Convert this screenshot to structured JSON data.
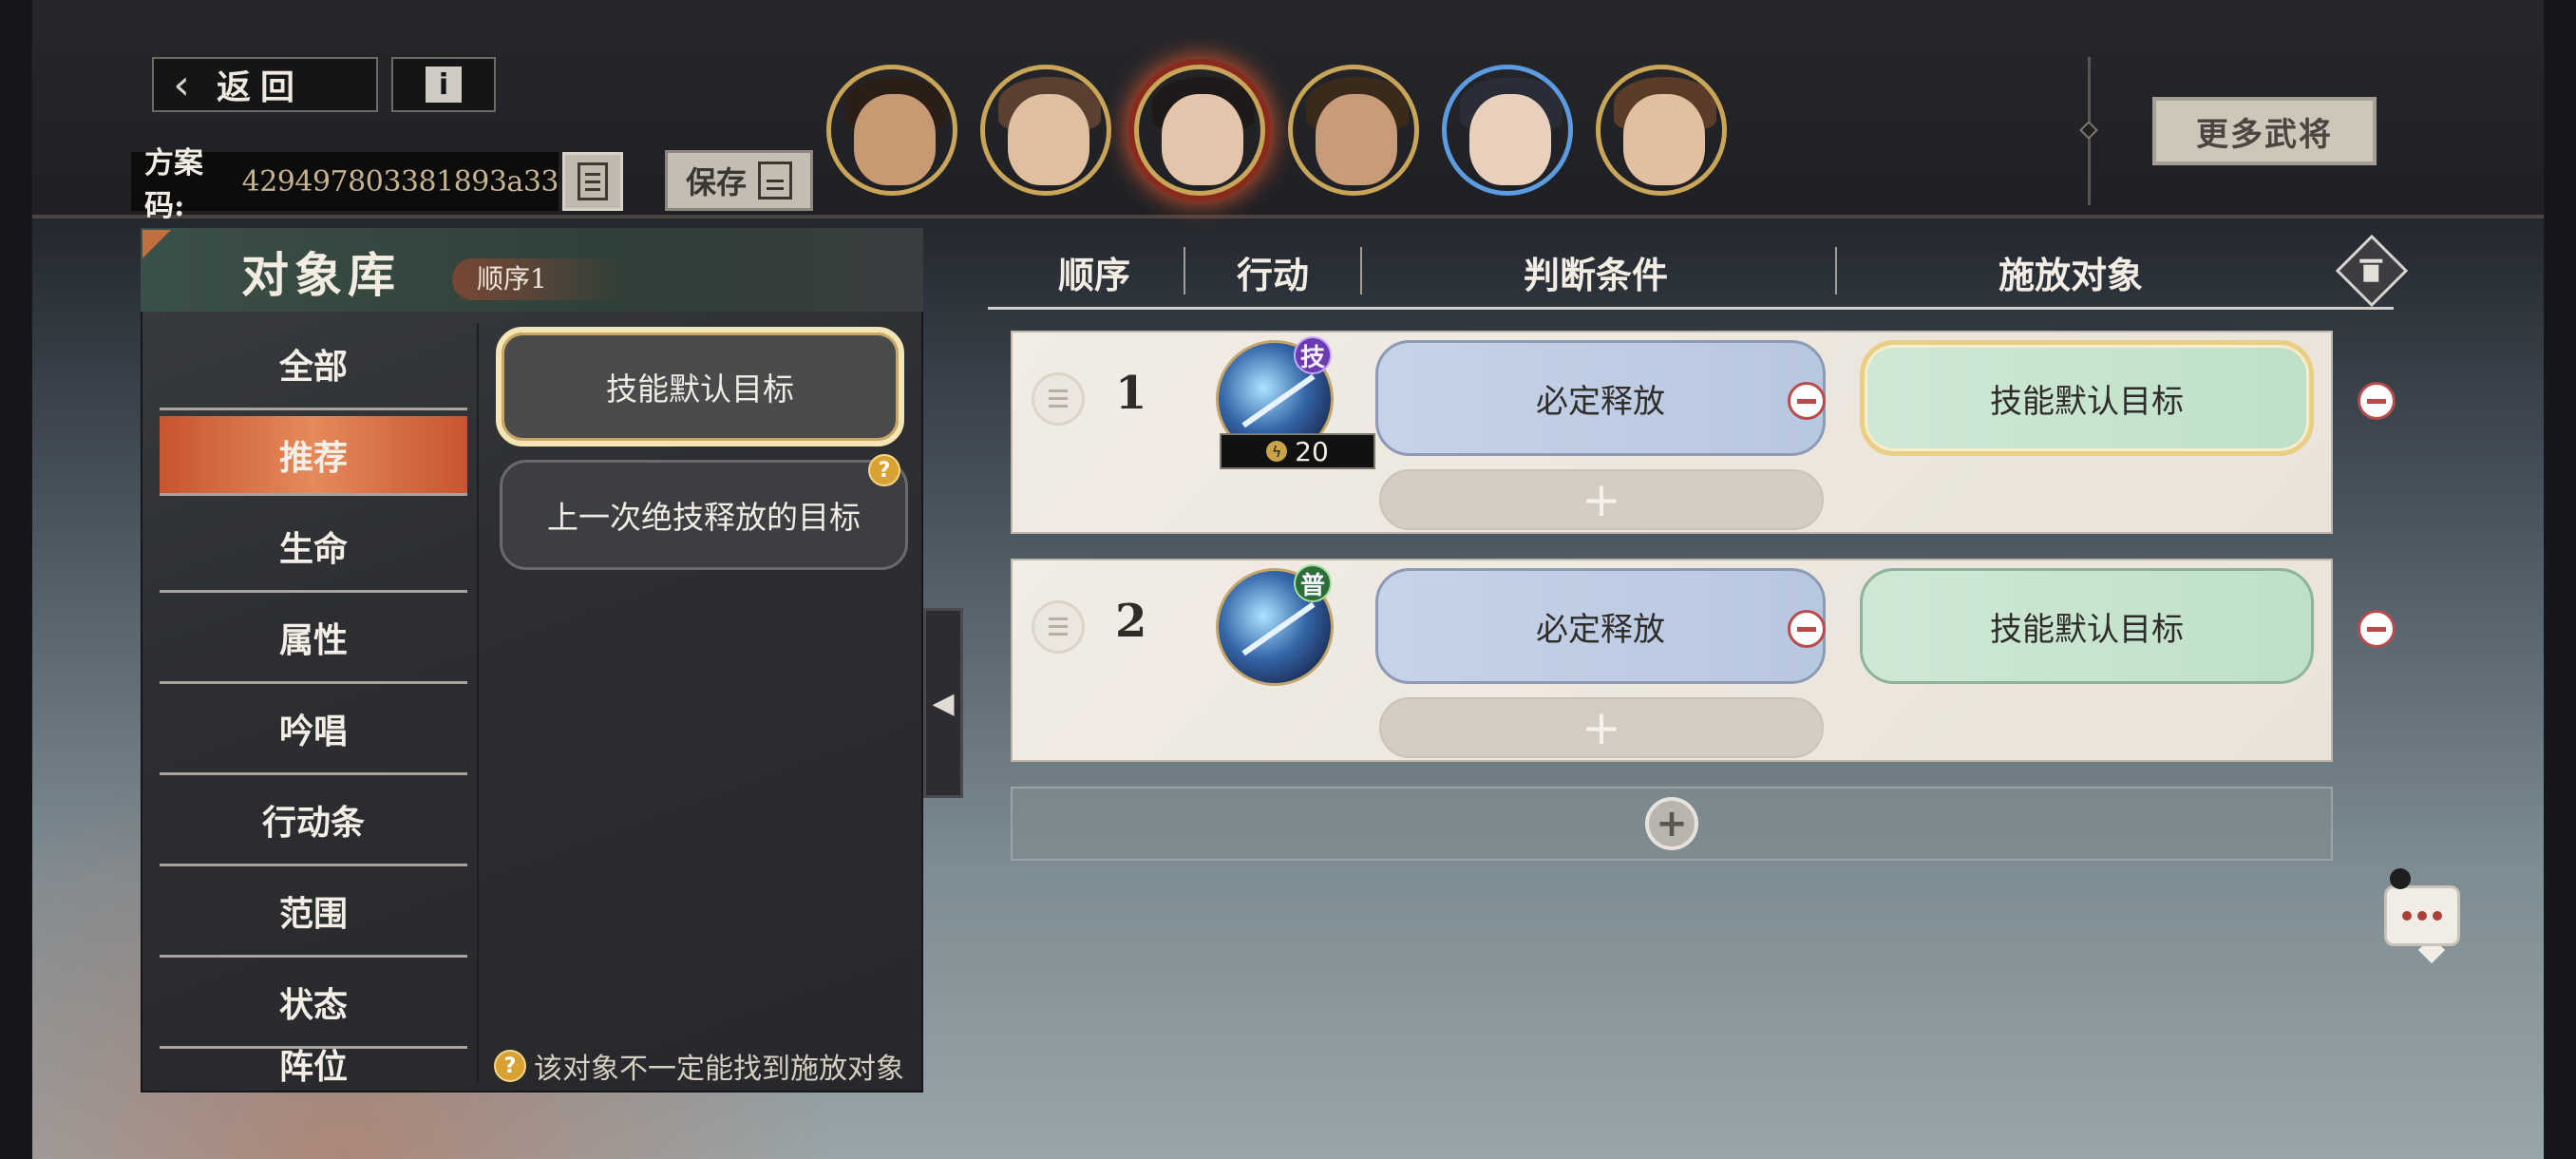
{
  "header": {
    "back_label": "返回",
    "info_icon": "info-icon",
    "plan_code_label": "方案码:",
    "plan_code_value": "429497803381893a33",
    "save_label": "保存",
    "more_generals_label": "更多武将"
  },
  "heroes": [
    {
      "name": "hero-1",
      "selected": false
    },
    {
      "name": "hero-2",
      "selected": false
    },
    {
      "name": "hero-3",
      "selected": true
    },
    {
      "name": "hero-4",
      "selected": false
    },
    {
      "name": "hero-5",
      "selected": false
    },
    {
      "name": "hero-6",
      "selected": false
    }
  ],
  "library": {
    "title": "对象库",
    "order_badge": "顺序1",
    "categories": [
      "全部",
      "推荐",
      "生命",
      "属性",
      "吟唱",
      "行动条",
      "范围",
      "状态",
      "阵位"
    ],
    "active_category": "推荐",
    "targets": [
      "技能默认目标",
      "上一次绝技释放的目标"
    ],
    "hint": "该对象不一定能找到施放对象"
  },
  "table": {
    "headers": {
      "order": "顺序",
      "action": "行动",
      "condition": "判断条件",
      "target": "施放对象"
    },
    "rows": [
      {
        "num": "1",
        "skill_tag": "技",
        "cost": "20",
        "condition": "必定释放",
        "target": "技能默认目标"
      },
      {
        "num": "2",
        "skill_tag": "普",
        "condition": "必定释放",
        "target": "技能默认目标"
      }
    ]
  },
  "colors": {
    "accent_orange": "#d9693f",
    "condition_blue": "#c2d0e6",
    "target_green": "#c9e5d0",
    "gold": "#c9a55a"
  }
}
